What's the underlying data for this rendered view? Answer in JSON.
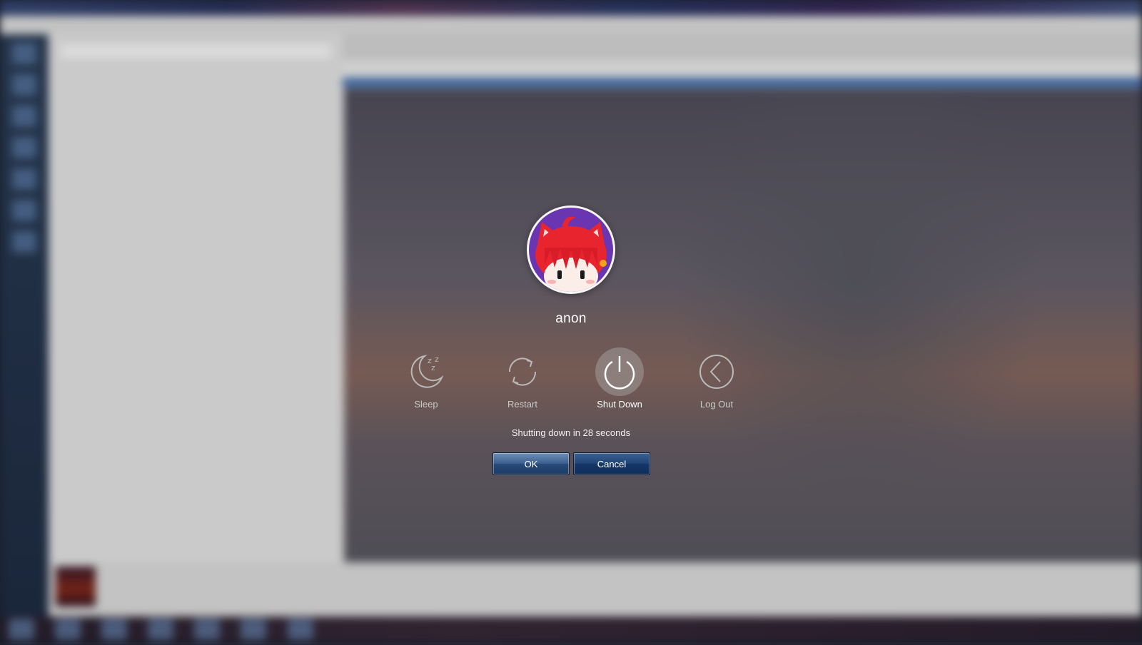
{
  "dialog": {
    "username": "anon",
    "actions": [
      {
        "label": "Sleep",
        "icon": "sleep-moon-icon",
        "selected": false
      },
      {
        "label": "Restart",
        "icon": "restart-icon",
        "selected": false
      },
      {
        "label": "Shut Down",
        "icon": "power-icon",
        "selected": true
      },
      {
        "label": "Log Out",
        "icon": "log-out-chevron-icon",
        "selected": false
      }
    ],
    "countdown_text": "Shutting down in 28 seconds",
    "ok_label": "OK",
    "cancel_label": "Cancel"
  },
  "colors": {
    "button_gradient_top": "#6e8fb6",
    "button_gradient_bottom": "#1e3c66",
    "avatar_bg": "#6a35b0",
    "avatar_hair": "#e8252f",
    "label_selected": "#ffffff",
    "label_normal": "#c9c9c9"
  }
}
